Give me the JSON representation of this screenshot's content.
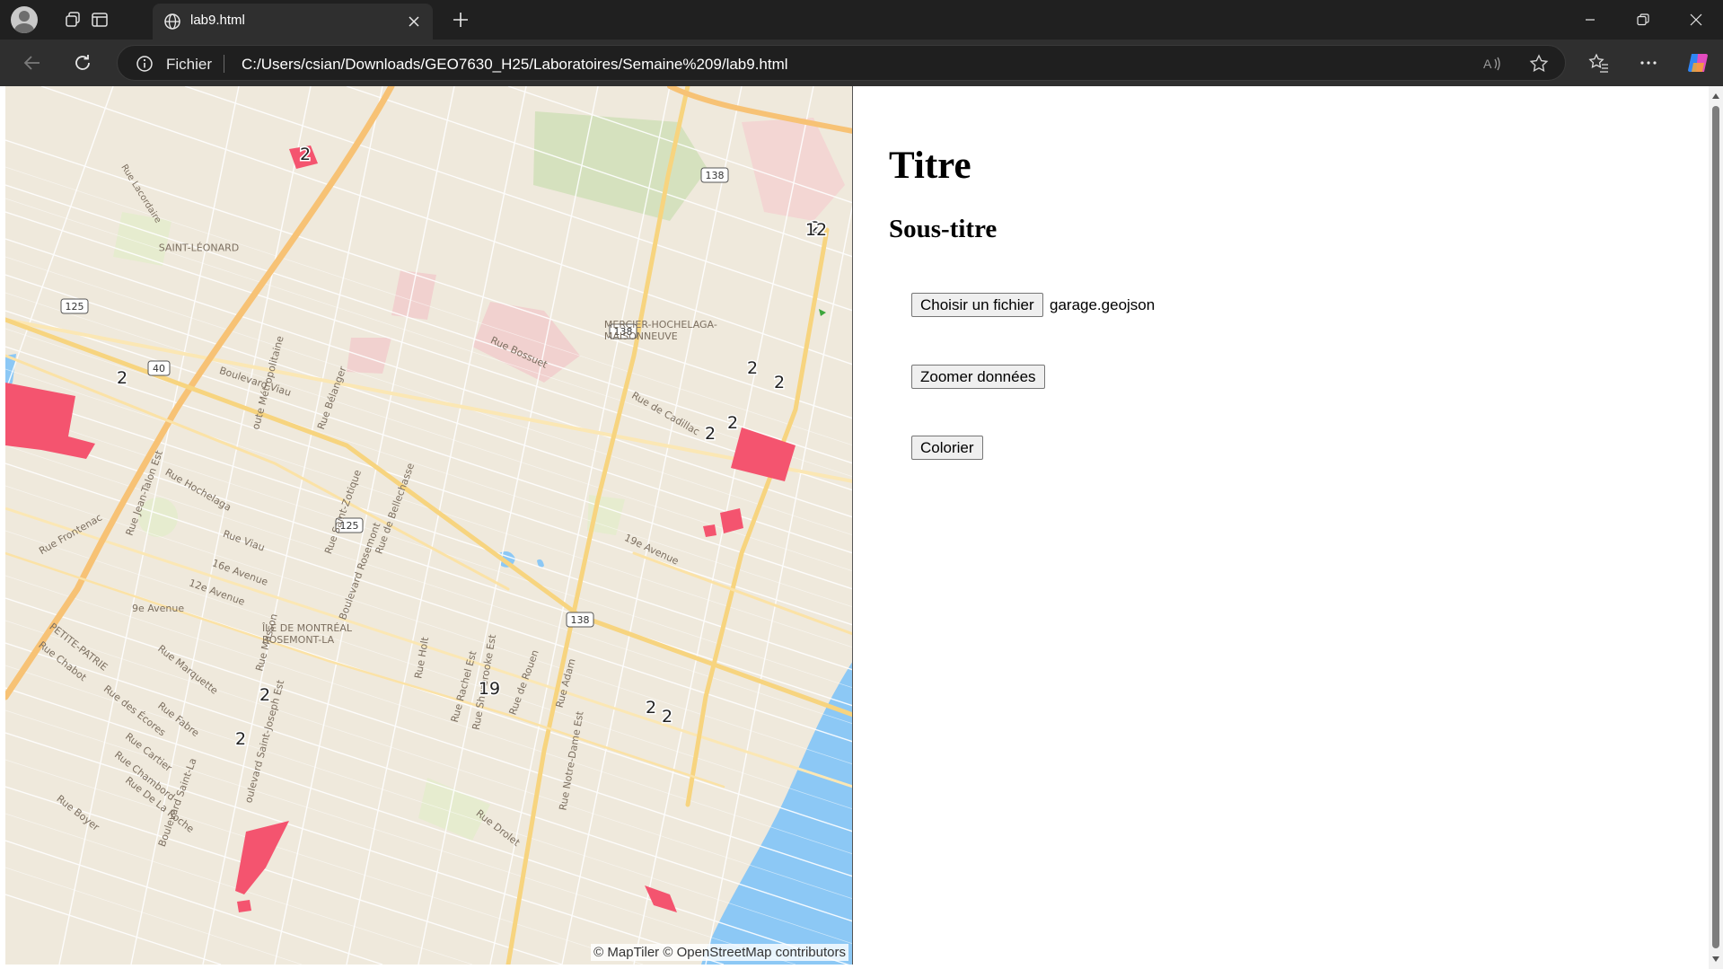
{
  "browser": {
    "tab_title": "lab9.html",
    "site_info_label": "Fichier",
    "url": "C:/Users/csian/Downloads/GEO7630_H25/Laboratoires/Semaine%209/lab9.html"
  },
  "page": {
    "title": "Titre",
    "subtitle": "Sous-titre",
    "file_button_label": "Choisir un fichier",
    "file_name": "garage.geojson",
    "zoom_button_label": "Zoomer données",
    "color_button_label": "Colorier"
  },
  "map": {
    "attribution": "© MapTiler © OpenStreetMap contributors",
    "labels": [
      {
        "name": "Rue Lacordaire",
        "text": "Rue Lacordaire"
      },
      {
        "name": "Saint-Léonard",
        "text": "SAINT-LÉONARD"
      },
      {
        "name": "Mercier-Hochelaga",
        "text": "MERCIER-HOCHELAGA-"
      },
      {
        "name": "Maisonneuve",
        "text": "MAISONNEUVE"
      },
      {
        "name": "Rue Bossuet",
        "text": "Rue Bossuet"
      },
      {
        "name": "Boulevard Viau",
        "text": "Boulevard Viau"
      },
      {
        "name": "Rue de Cadillac",
        "text": "Rue de Cadillac"
      },
      {
        "name": "Rue Hochelaga",
        "text": "Rue Hochelaga"
      },
      {
        "name": "19e Avenue",
        "text": "19e Avenue"
      },
      {
        "name": "Rue Viau",
        "text": "Rue Viau"
      },
      {
        "name": "16e Avenue",
        "text": "16e Avenue"
      },
      {
        "name": "12e Avenue",
        "text": "12e Avenue"
      },
      {
        "name": "9e Avenue",
        "text": "9e Avenue"
      },
      {
        "name": "Île de Montréal",
        "text": "ÎLE DE MONTRÉAL"
      },
      {
        "name": "Rosemont-La",
        "text": "ROSEMONT-LA"
      },
      {
        "name": "Petite-Patrie",
        "text": "PETITE-PATRIE"
      },
      {
        "name": "Rue Chabot",
        "text": "Rue Chabot"
      },
      {
        "name": "Rue Marquette",
        "text": "Rue Marquette"
      },
      {
        "name": "Rue des Écores",
        "text": "Rue des Écores"
      },
      {
        "name": "Rue Fabre",
        "text": "Rue Fabre"
      },
      {
        "name": "Rue Cartier",
        "text": "Rue Cartier"
      },
      {
        "name": "Rue Chambord",
        "text": "Rue Chambord"
      },
      {
        "name": "Rue De La Roche",
        "text": "Rue De La Roche"
      },
      {
        "name": "Rue Boyer",
        "text": "Rue Boyer"
      },
      {
        "name": "Rue Drolet",
        "text": "Rue Drolet"
      },
      {
        "name": "Rue Frontenac",
        "text": "Rue Frontenac"
      },
      {
        "name": "Autoroute Métropolitaine",
        "text": "oute Métropolitaine"
      },
      {
        "name": "Rue Bélanger",
        "text": "Rue Bélanger"
      },
      {
        "name": "Rue Saint-Zotique",
        "text": "Rue Saint-Zotique"
      },
      {
        "name": "Rue de Bellechasse",
        "text": "Rue de Bellechasse"
      },
      {
        "name": "Boulevard Rosemont",
        "text": "Boulevard Rosemont"
      },
      {
        "name": "Rue Masson",
        "text": "Rue Masson"
      },
      {
        "name": "Rue Holt",
        "text": "Rue Holt"
      },
      {
        "name": "Rue Rachel Est",
        "text": "Rue Rachel Est"
      },
      {
        "name": "Rue Sherbrooke Est",
        "text": "Rue Sherbrooke Est"
      },
      {
        "name": "Rue de Rouen",
        "text": "Rue de Rouen"
      },
      {
        "name": "Rue Adam",
        "text": "Rue Adam"
      },
      {
        "name": "Rue Notre-Dame Est",
        "text": "Rue Notre-Dame Est"
      },
      {
        "name": "Rue Jean-Talon Est",
        "text": "Rue Jean-Talon Est"
      },
      {
        "name": "Boulevard Saint-Joseph Est",
        "text": "oulevard Saint-Joseph Est"
      },
      {
        "name": "Boulevard Saint-Laurent",
        "text": "Boulevard Saint-La"
      }
    ],
    "shields": [
      "138",
      "138",
      "138",
      "125",
      "125",
      "40"
    ],
    "cluster_counts": [
      "2",
      "2",
      "2",
      "2",
      "2",
      "2",
      "2",
      "2",
      "2",
      "2",
      "2",
      "12",
      "19"
    ]
  },
  "colors": {
    "map_background": "#efe9dc",
    "water": "#8cc8f5",
    "highway": "#f7c96b",
    "feature_fill": "#f4546f",
    "park": "#d5e1be"
  },
  "icons": {
    "back": "back-arrow-icon",
    "refresh": "refresh-icon",
    "info": "info-icon",
    "favorites": "favorites-icon"
  }
}
